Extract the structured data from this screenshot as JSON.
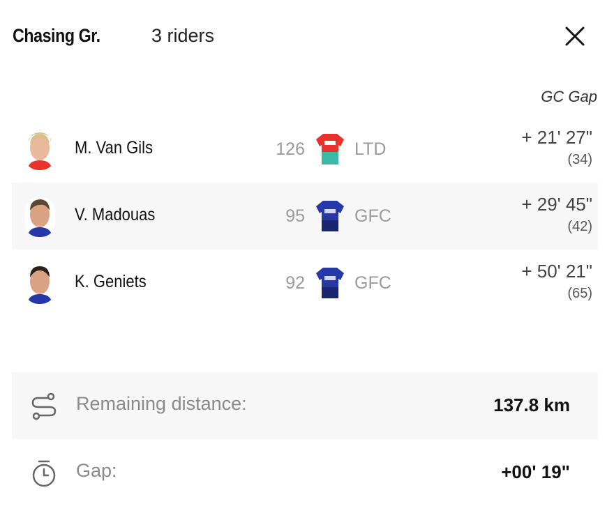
{
  "header": {
    "group_title": "Chasing Gr.",
    "rider_count": "3 riders",
    "close_icon": "close-icon"
  },
  "columns": {
    "gc_gap_label": "GC Gap"
  },
  "riders": [
    {
      "name": "M. Van Gils",
      "bib": "126",
      "team": "LTD",
      "jersey_colors": [
        "#e8322b",
        "#3cb8a8"
      ],
      "gc_gap": "+ 21' 27\"",
      "gc_rank": "(34)"
    },
    {
      "name": "V. Madouas",
      "bib": "95",
      "team": "GFC",
      "jersey_colors": [
        "#2637a8",
        "#1b2670"
      ],
      "gc_gap": "+ 29' 45\"",
      "gc_rank": "(42)"
    },
    {
      "name": "K. Geniets",
      "bib": "92",
      "team": "GFC",
      "jersey_colors": [
        "#2637a8",
        "#1b2670"
      ],
      "gc_gap": "+ 50' 21\"",
      "gc_rank": "(65)"
    }
  ],
  "info": {
    "remaining": {
      "icon": "route-icon",
      "label": "Remaining distance:",
      "value": "137.8 km"
    },
    "gap": {
      "icon": "stopwatch-icon",
      "label": "Gap:",
      "value": "+00' 19\""
    }
  }
}
